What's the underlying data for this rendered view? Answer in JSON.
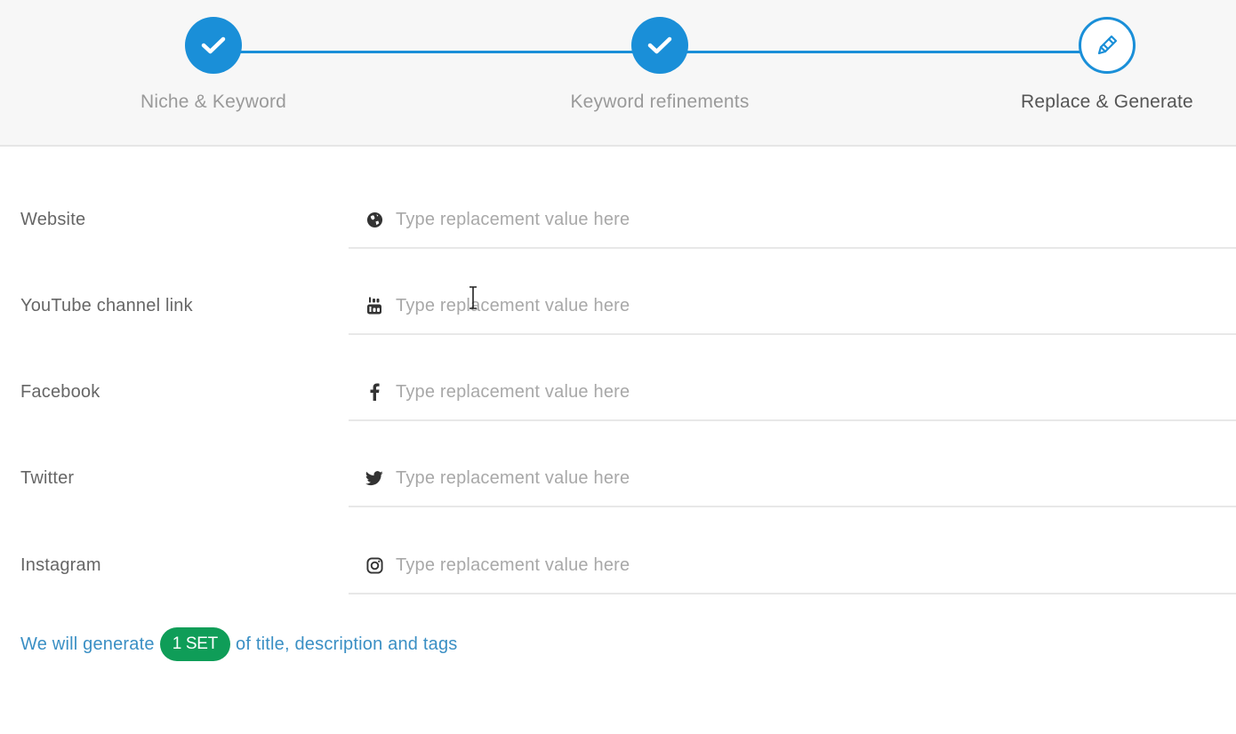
{
  "stepper": {
    "steps": [
      {
        "label": "Niche & Keyword",
        "state": "done",
        "icon": "check-icon"
      },
      {
        "label": "Keyword refinements",
        "state": "done",
        "icon": "check-icon"
      },
      {
        "label": "Replace & Generate",
        "state": "active",
        "icon": "pencil-icon"
      }
    ],
    "accent_color": "#1a8fd8"
  },
  "form": {
    "fields": [
      {
        "label": "Website",
        "icon": "globe-icon",
        "placeholder": "Type replacement value here",
        "value": ""
      },
      {
        "label": "YouTube channel link",
        "icon": "youtube-icon",
        "placeholder": "Type replacement value here",
        "value": ""
      },
      {
        "label": "Facebook",
        "icon": "facebook-icon",
        "placeholder": "Type replacement value here",
        "value": ""
      },
      {
        "label": "Twitter",
        "icon": "twitter-icon",
        "placeholder": "Type replacement value here",
        "value": ""
      },
      {
        "label": "Instagram",
        "icon": "instagram-icon",
        "placeholder": "Type replacement value here",
        "value": ""
      }
    ]
  },
  "generation": {
    "prefix": "We will generate",
    "badge": "1 SET",
    "suffix": "of title, description and tags",
    "badge_color": "#0f9d58"
  }
}
